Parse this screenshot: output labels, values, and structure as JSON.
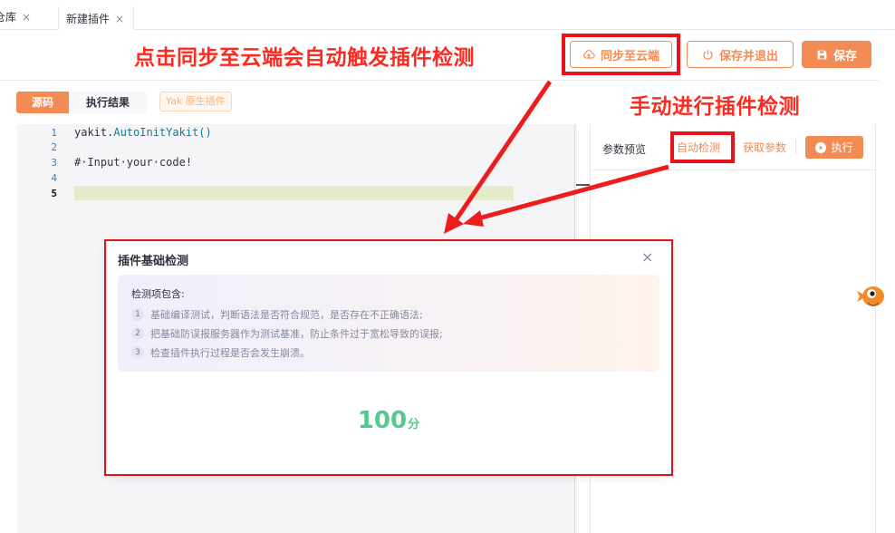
{
  "tabs": [
    {
      "label": "仓库",
      "close": "×"
    },
    {
      "label": "新建插件",
      "close": "×"
    }
  ],
  "annotations": {
    "sync_hint": "点击同步至云端会自动触发插件检测",
    "manual_hint": "手动进行插件检测"
  },
  "toolbar": {
    "sync_label": "同步至云端",
    "save_exit_label": "保存并退出",
    "save_label": "保存"
  },
  "subtabs": {
    "source": "源码",
    "result": "执行结果",
    "badge": "Yak 原生插件"
  },
  "editor": {
    "line_numbers": [
      "1",
      "2",
      "3",
      "4",
      "5"
    ],
    "line1_obj": "yakit.",
    "line1_fn": "AutoInitYakit()",
    "line3": "#·Input·your·code!"
  },
  "right_panel": {
    "title": "参数预览",
    "auto_check": "自动检测",
    "fetch_params": "获取参数",
    "execute": "执行"
  },
  "modal": {
    "title": "插件基础检测",
    "close": "×",
    "check_heading": "检测项包含:",
    "items": [
      {
        "num": "1",
        "text": "基础编译测试，判断语法是否符合规范，是否存在不正确语法;"
      },
      {
        "num": "2",
        "text": "把基础防误报服务器作为测试基准，防止条件过于宽松导致的误报;"
      },
      {
        "num": "3",
        "text": "检查插件执行过程是否会发生崩溃。"
      }
    ],
    "score": "100",
    "score_unit": "分"
  },
  "colors": {
    "accent": "#f28b54",
    "annotation_red": "#ff2a1f",
    "score_green": "#56c991"
  }
}
